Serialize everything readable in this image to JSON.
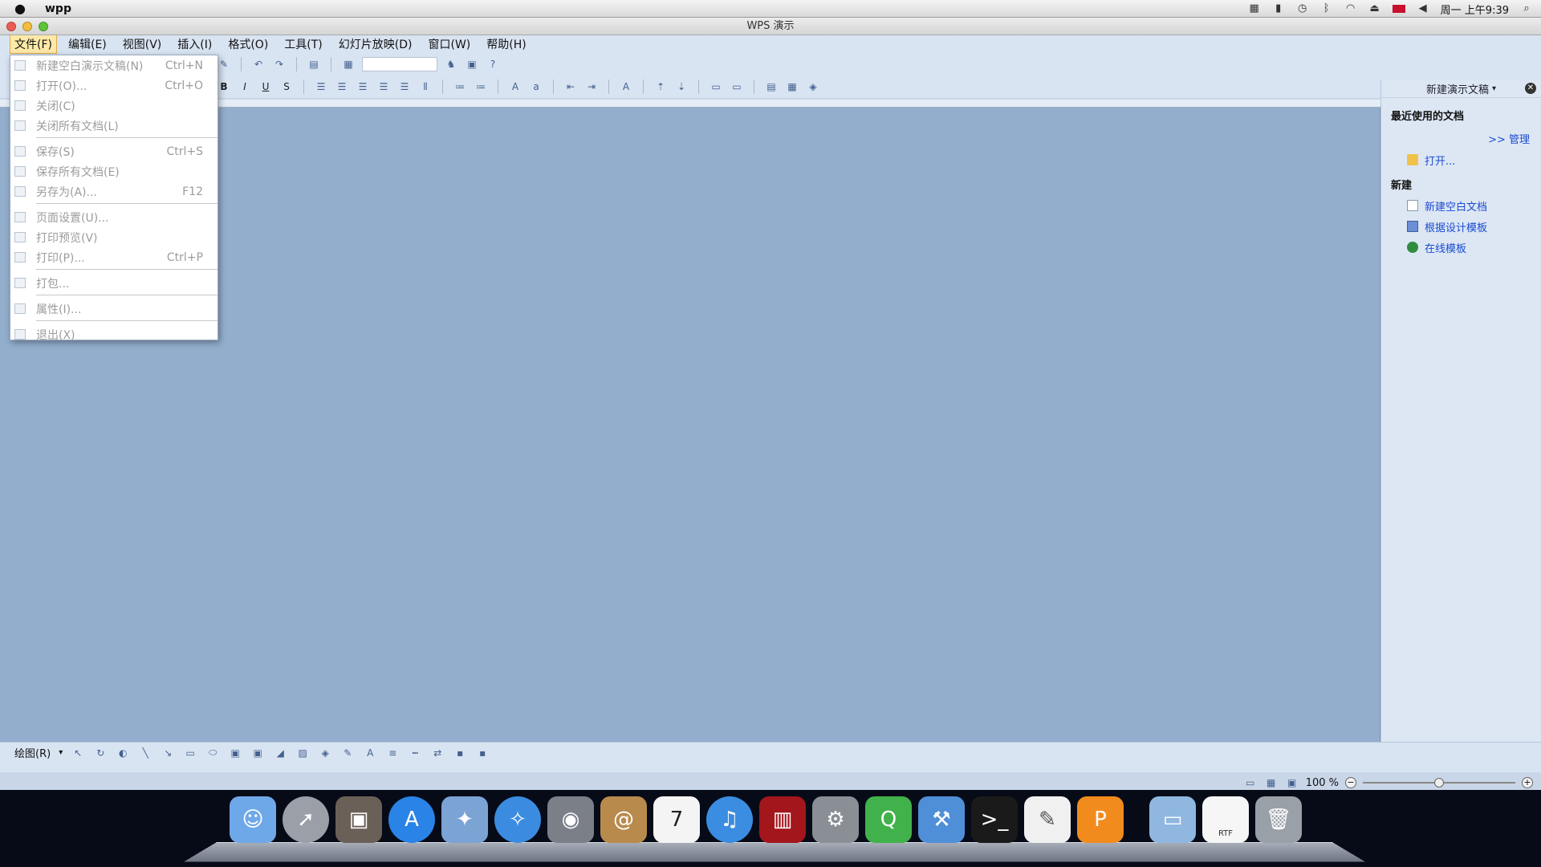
{
  "menubar": {
    "apple": "",
    "app_name": "wpp",
    "clock": "周一 上午9:39",
    "status_icons": [
      "input-source-icon",
      "lock-icon",
      "time-machine-icon",
      "bluetooth-icon",
      "wifi-icon",
      "eject-icon",
      "flag-icon",
      "volume-icon",
      "spotlight-icon"
    ]
  },
  "window": {
    "title": "WPS 演示"
  },
  "app_menu": [
    {
      "label": "文件(F)",
      "active": true
    },
    {
      "label": "编辑(E)"
    },
    {
      "label": "视图(V)"
    },
    {
      "label": "插入(I)"
    },
    {
      "label": "格式(O)"
    },
    {
      "label": "工具(T)"
    },
    {
      "label": "幻灯片放映(D)"
    },
    {
      "label": "窗口(W)"
    },
    {
      "label": "帮助(H)"
    }
  ],
  "file_menu": [
    {
      "label": "新建空白演示文稿(N)",
      "shortcut": "Ctrl+N"
    },
    {
      "label": "打开(O)...",
      "shortcut": "Ctrl+O"
    },
    {
      "label": "关闭(C)",
      "shortcut": ""
    },
    {
      "label": "关闭所有文档(L)",
      "shortcut": ""
    },
    {
      "sep": true
    },
    {
      "label": "保存(S)",
      "shortcut": "Ctrl+S"
    },
    {
      "label": "保存所有文档(E)",
      "shortcut": ""
    },
    {
      "label": "另存为(A)...",
      "shortcut": "F12"
    },
    {
      "sep": true
    },
    {
      "label": "页面设置(U)...",
      "shortcut": ""
    },
    {
      "label": "打印预览(V)",
      "shortcut": ""
    },
    {
      "label": "打印(P)...",
      "shortcut": "Ctrl+P"
    },
    {
      "sep": true
    },
    {
      "label": "打包...",
      "shortcut": ""
    },
    {
      "sep": true
    },
    {
      "label": "属性(I)...",
      "shortcut": ""
    },
    {
      "sep": true
    },
    {
      "label": "退出(X)",
      "shortcut": ""
    }
  ],
  "format_toolbar": {
    "bold": "B",
    "italic": "I",
    "underline": "U",
    "shadow": "S"
  },
  "task_pane": {
    "header": "新建演示文稿",
    "recent_title": "最近使用的文档",
    "manage": ">> 管理",
    "open": "打开...",
    "new_title": "新建",
    "new_blank": "新建空白文档",
    "from_template": "根据设计模板",
    "online_template": "在线模板"
  },
  "drawbar": {
    "draw_label": "绘图(R)"
  },
  "statusbar": {
    "zoom": "100 %"
  },
  "colors": {
    "canvas": "#93aecd",
    "ui_bg": "#d9e4f2",
    "link": "#1a4bd1",
    "menu_highlight": "#ffe9a8"
  },
  "dock": {
    "apps": [
      "finder-icon",
      "launchpad-icon",
      "image-capture-icon",
      "app-store-icon",
      "preview-icon",
      "safari-icon",
      "facetime-icon",
      "contacts-icon",
      "calendar-icon",
      "itunes-icon",
      "photo-booth-icon",
      "system-preferences-icon",
      "qt-creator-icon",
      "xcode-icon",
      "terminal-icon",
      "textedit-icon",
      "wps-presentation-icon",
      "folder-icon",
      "rtf-document-icon",
      "trash-icon"
    ],
    "calendar_day": "7",
    "rtf_label": "RTF"
  }
}
